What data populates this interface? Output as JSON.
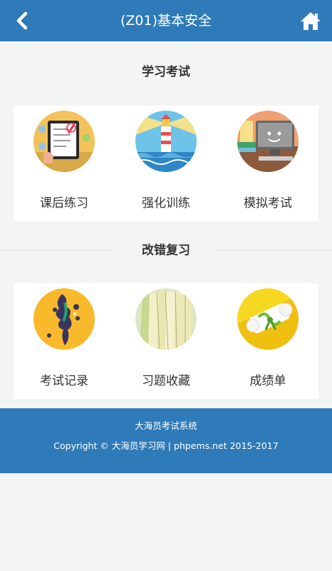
{
  "header": {
    "title": "(Z01)基本安全",
    "back_icon": "chevron-left-icon",
    "home_icon": "home-icon",
    "background": "#2f7ab8"
  },
  "study_section": {
    "title": "学习考试",
    "items": [
      {
        "label": "课后练习",
        "icon": "tablet-checklist-icon"
      },
      {
        "label": "强化训练",
        "icon": "lighthouse-icon"
      },
      {
        "label": "模拟考试",
        "icon": "computer-monitor-icon"
      }
    ]
  },
  "review_section": {
    "title": "改错复习",
    "items": [
      {
        "label": "考试记录",
        "icon": "paint-splash-icon"
      },
      {
        "label": "习题收藏",
        "icon": "book-pages-icon"
      },
      {
        "label": "成绩单",
        "icon": "certificate-scroll-icon"
      }
    ]
  },
  "footer": {
    "line1": "大海员考试系统",
    "line2": "Copyright © 大海员学习网 | phpems.net 2015-2017"
  }
}
